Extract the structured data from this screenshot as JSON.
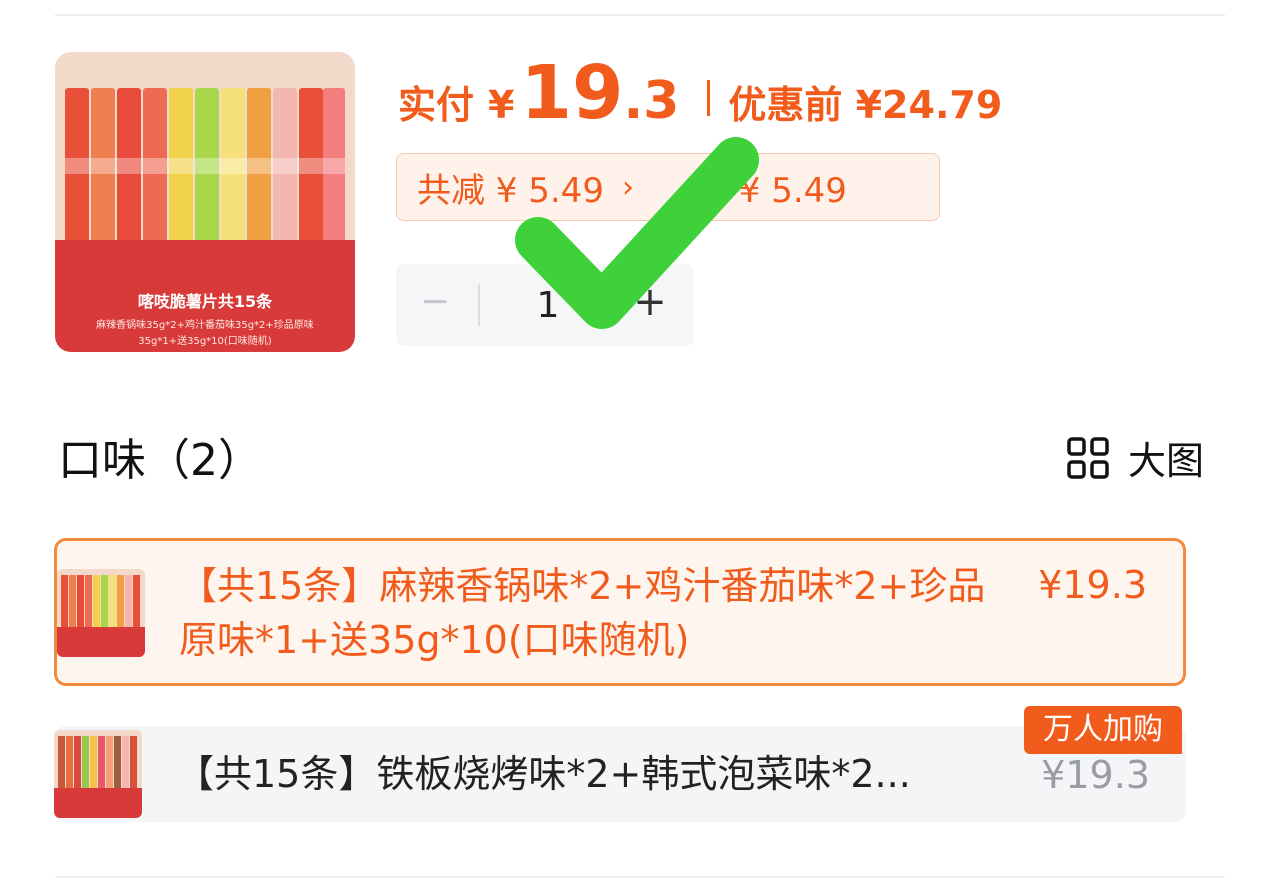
{
  "product": {
    "image_banner_title": "喀吱脆薯片共15条",
    "image_banner_sub": "麻辣香锅味35g*2+鸡汁番茄味35g*2+珍品原味35g*1+送35g*10(口味随机)"
  },
  "price": {
    "label": "实付",
    "currency": "¥",
    "amount_int": "19",
    "amount_dec": ".3",
    "original_label": "优惠前 ¥24.79"
  },
  "discount": {
    "total": "共减 ¥ 5.49",
    "chevron": "›",
    "subsidy": "贴 ¥ 5.49"
  },
  "stepper": {
    "minus": "−",
    "quantity": "1",
    "plus": "+"
  },
  "flavor": {
    "title": "口味（2）",
    "view_label": "大图",
    "options": [
      {
        "text": "【共15条】麻辣香锅味*2+鸡汁番茄味*2+珍品原味*1+送35g*10(口味随机)",
        "price": "¥19.3",
        "selected": true
      },
      {
        "text": "【共15条】铁板烧烤味*2+韩式泡菜味*2...",
        "price": "¥19.3",
        "selected": false
      }
    ],
    "hot_badge": "万人加购"
  },
  "colors": {
    "accent": "#f15b1c",
    "selected_border": "#f08a3e",
    "check_green": "#3fd13a"
  }
}
